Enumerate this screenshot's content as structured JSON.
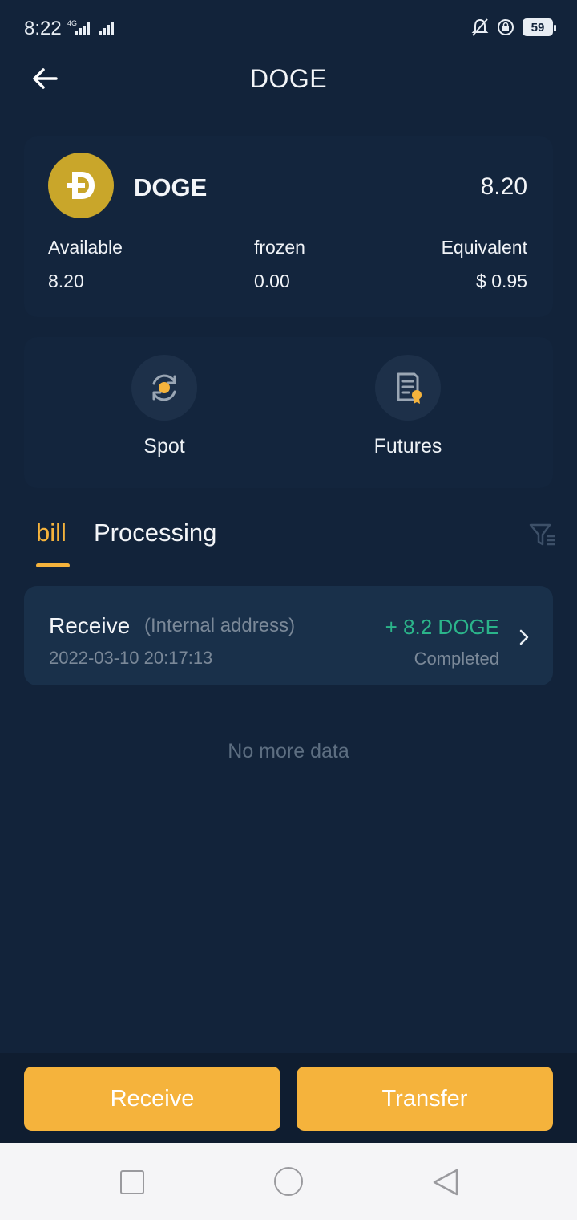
{
  "status_bar": {
    "time": "8:22",
    "network": "4G",
    "battery": "59"
  },
  "header": {
    "title": "DOGE"
  },
  "asset": {
    "symbol": "DOGE",
    "logo_glyph": "Ð",
    "total": "8.20",
    "available_label": "Available",
    "available_value": "8.20",
    "frozen_label": "frozen",
    "frozen_value": "0.00",
    "equivalent_label": "Equivalent",
    "equivalent_value": "$ 0.95"
  },
  "actions": [
    {
      "label": "Spot",
      "icon": "swap-circle-icon"
    },
    {
      "label": "Futures",
      "icon": "contract-document-icon"
    }
  ],
  "tabs": {
    "bill": "bill",
    "processing": "Processing",
    "active": "bill"
  },
  "records": [
    {
      "type": "Receive",
      "note": "(Internal address)",
      "time": "2022-03-10 20:17:13",
      "amount": "+ 8.2 DOGE",
      "status": "Completed"
    }
  ],
  "list_footer": "No more data",
  "buttons": {
    "receive": "Receive",
    "transfer": "Transfer"
  },
  "colors": {
    "background": "#12233a",
    "accent": "#f5b33c",
    "positive": "#2bb48a",
    "muted": "#7a8898",
    "coin": "#c9a62a"
  }
}
